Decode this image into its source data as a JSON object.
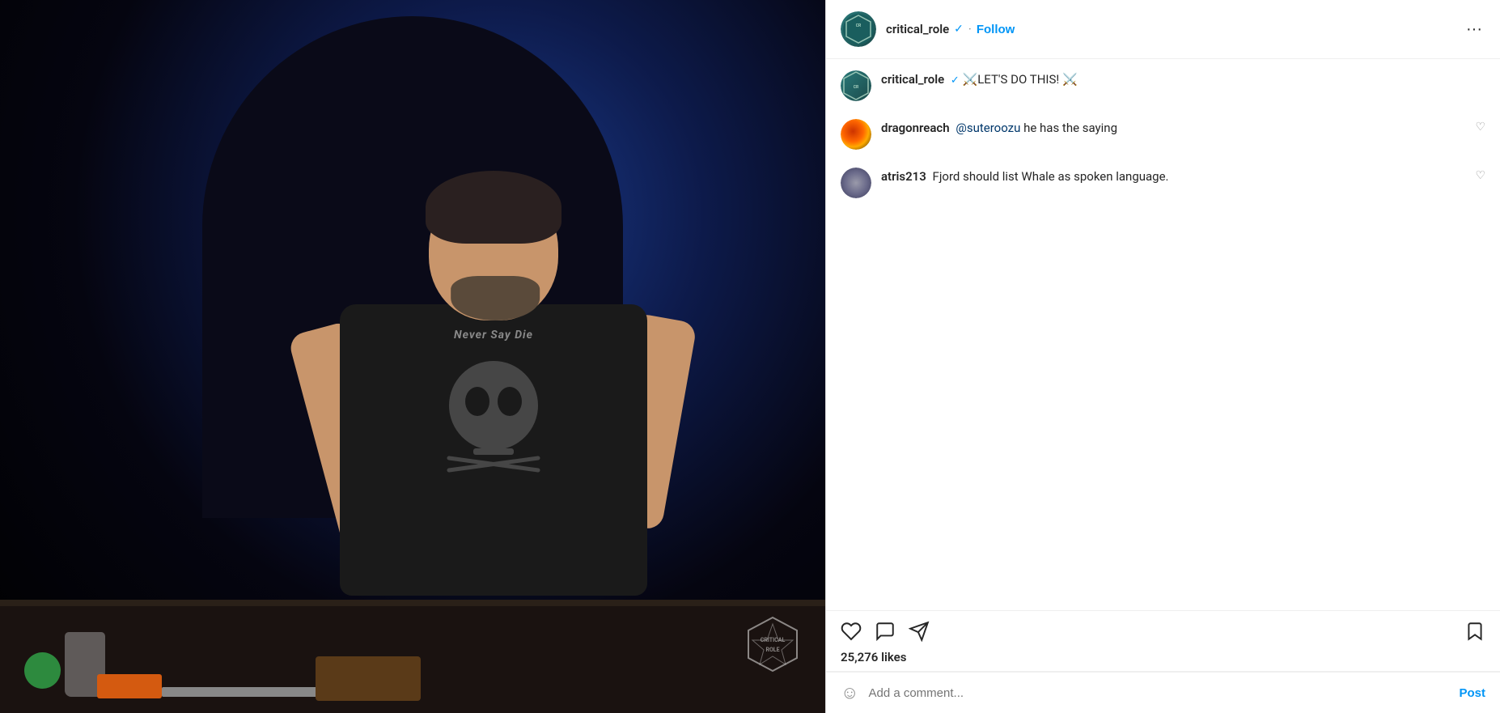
{
  "header": {
    "username": "critical_role",
    "follow_label": "Follow",
    "more_icon": "⋯",
    "verified": "✓"
  },
  "post": {
    "caption_username": "critical_role",
    "caption_text": "⚔️LET'S DO THIS! ⚔️"
  },
  "comments": [
    {
      "username": "dragonreach",
      "mention": "@suteroozu",
      "text": " he has the saying",
      "avatar_style": "dragon"
    },
    {
      "username": "atris213",
      "mention": "",
      "text": " Fjord should list Whale as spoken language.",
      "avatar_style": "atris"
    }
  ],
  "actions": {
    "likes": "25,276 likes"
  },
  "comment_input": {
    "placeholder": "Add a comment...",
    "post_label": "Post",
    "emoji": "☺"
  },
  "watermark": {
    "text": "Critical Role"
  },
  "shirt_text": "Never Say Die"
}
